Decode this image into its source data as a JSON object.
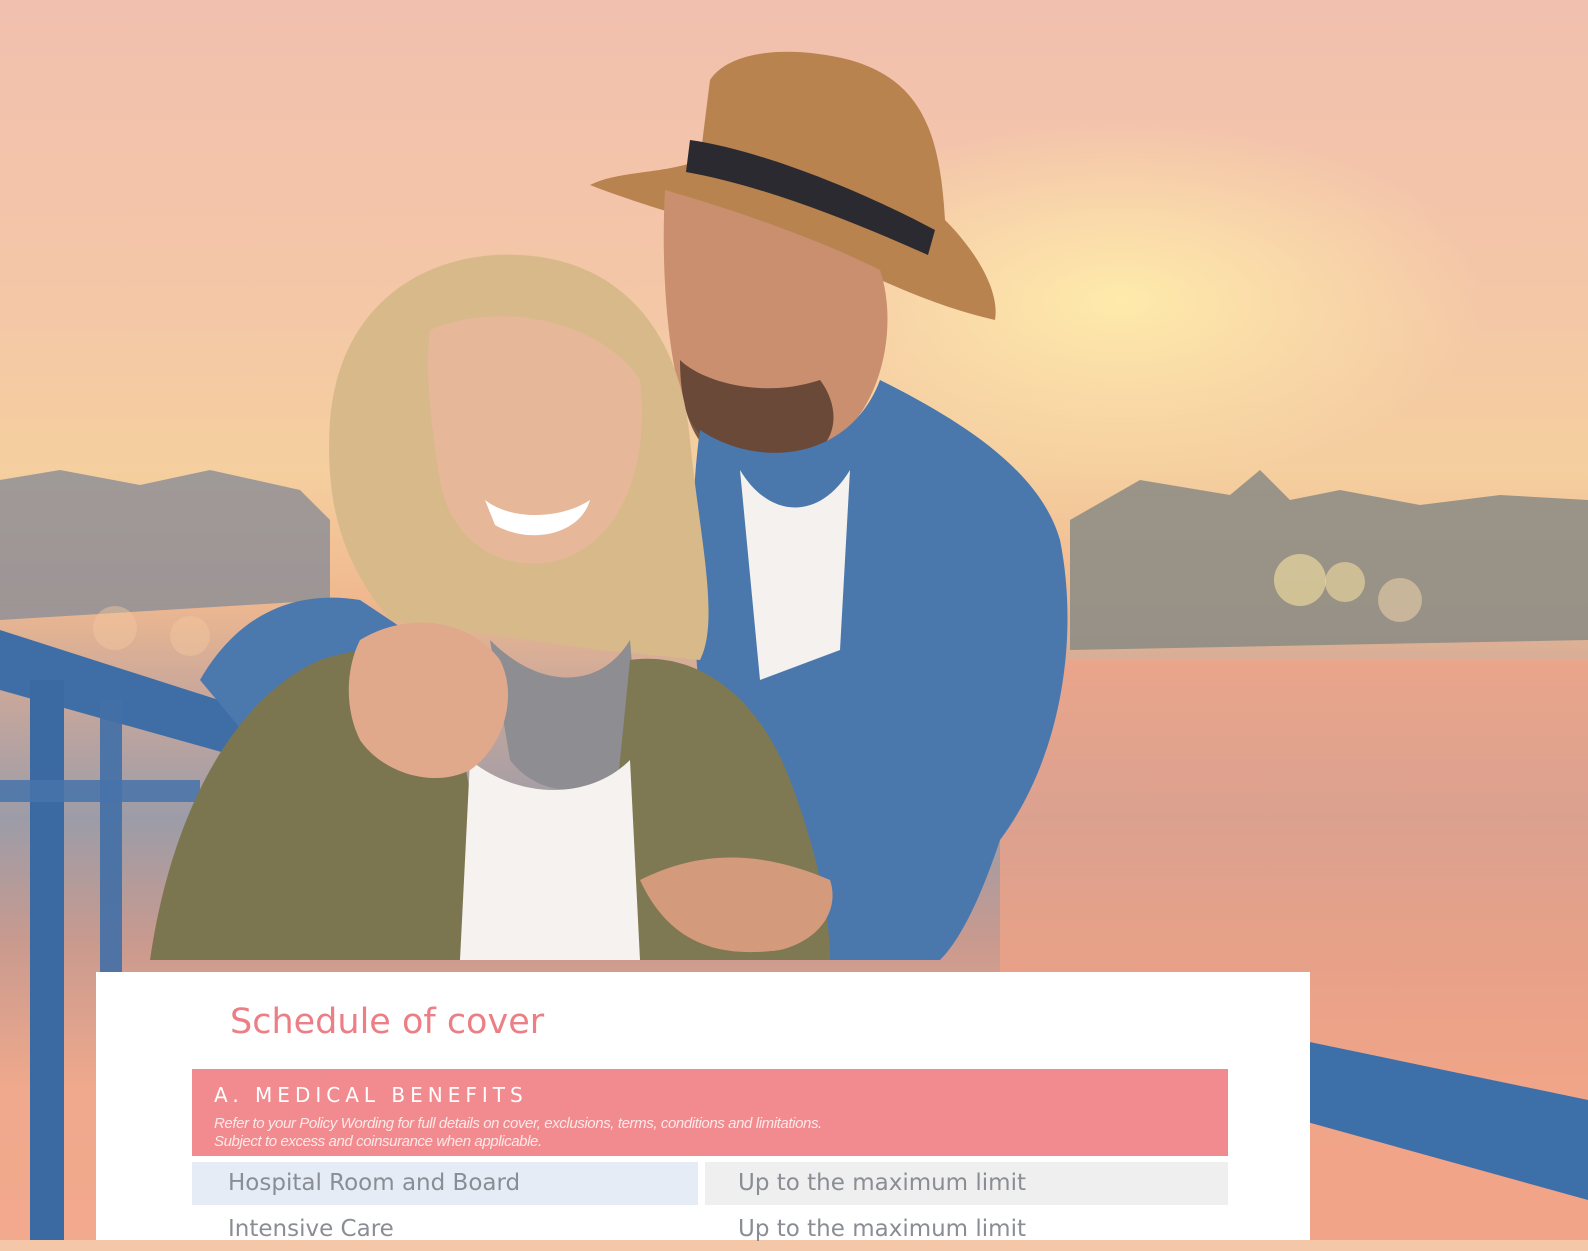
{
  "colors": {
    "accent": "#f28b8f",
    "title": "#ec7f86",
    "row_label_bg": "#e5ecf5",
    "row_value_bg": "#efefef",
    "body_text": "#8a8e94"
  },
  "document": {
    "title": "Schedule of cover",
    "section": {
      "name": "A. MEDICAL BENEFITS",
      "note_lines": [
        "Refer to your Policy Wording for full details on cover, exclusions, terms, conditions and limitations.",
        "Subject to excess and coinsurance when applicable."
      ]
    },
    "benefits": [
      {
        "name": "Hospital Room and Board",
        "limit": "Up to the maximum limit"
      },
      {
        "name": "Intensive Care",
        "limit": "Up to the maximum limit"
      }
    ]
  }
}
